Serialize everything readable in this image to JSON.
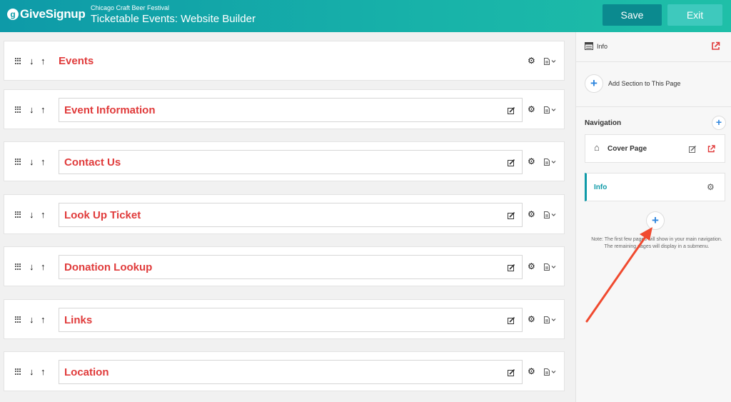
{
  "header": {
    "logo_mark": "g",
    "logo_text": "GiveSignup",
    "event_name": "Chicago Craft Beer Festival",
    "title": "Ticketable Events: Website Builder",
    "save_label": "Save",
    "exit_label": "Exit"
  },
  "sections": [
    {
      "title": "Events",
      "editable_box": false
    },
    {
      "title": "Event Information",
      "editable_box": true
    },
    {
      "title": "Contact Us",
      "editable_box": true
    },
    {
      "title": "Look Up Ticket",
      "editable_box": true
    },
    {
      "title": "Donation Lookup",
      "editable_box": true
    },
    {
      "title": "Links",
      "editable_box": true
    },
    {
      "title": "Location",
      "editable_box": true
    }
  ],
  "icons": {
    "move_down": "↓",
    "move_up": "↑",
    "gear": "⚙",
    "home": "⌂",
    "plus": "+"
  },
  "panel": {
    "page_label": "Info",
    "add_section_label": "Add Section to This Page",
    "navigation_heading": "Navigation",
    "nav_items": [
      {
        "label": "Cover Page",
        "active": false
      },
      {
        "label": "Info",
        "active": true
      }
    ],
    "note": "Note: The first few pages will show in your main navigation. The remaining pages will display in a submenu."
  },
  "colors": {
    "header_start": "#0e9aa8",
    "header_end": "#1fbfa8",
    "save_bg": "#0b8a8f",
    "exit_bg": "#3ec9bd",
    "section_title": "#e03b3b",
    "active_nav": "#0e9aa8",
    "plus_blue": "#2f86de",
    "annotation_arrow": "#f04a2f",
    "external_link": "#e03b3b"
  }
}
